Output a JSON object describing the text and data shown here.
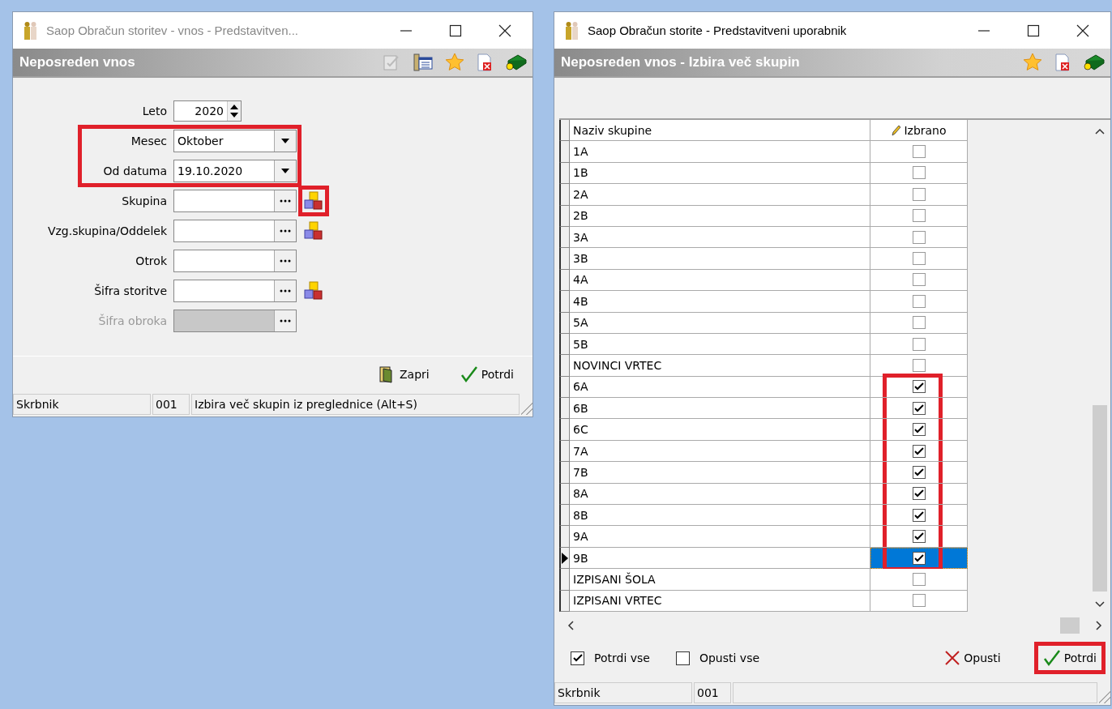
{
  "left_window": {
    "title": "Saop Obračun storitev - vnos - Predstavitven...",
    "active": false,
    "header": "Neposreden vnos",
    "toolbar": [
      {
        "kind": "edit"
      },
      {
        "kind": "list"
      },
      {
        "kind": "star"
      },
      {
        "kind": "close"
      },
      {
        "kind": "help"
      }
    ],
    "fields": [
      {
        "label": "Leto",
        "kind": "spinner",
        "value": "2020",
        "disabled": false,
        "highlighted": false
      },
      {
        "label": "Mesec",
        "kind": "dropdown",
        "value": "Oktober",
        "disabled": false,
        "highlighted": true
      },
      {
        "label": "Od datuma",
        "kind": "dropdown",
        "value": "19.10.2020",
        "disabled": false,
        "highlighted": true
      },
      {
        "label": "Skupina",
        "kind": "ellipsis",
        "disabled": false,
        "highlighted": false,
        "lookup": {
          "highlighted": true
        }
      },
      {
        "label": "Vzg.skupina/Oddelek",
        "kind": "ellipsis",
        "disabled": false,
        "highlighted": false,
        "lookup": {
          "highlighted": false
        }
      },
      {
        "label": "Otrok",
        "kind": "ellipsis",
        "disabled": false,
        "highlighted": false
      },
      {
        "label": "Šifra storitve",
        "kind": "ellipsis",
        "disabled": false,
        "highlighted": false,
        "lookup": {
          "highlighted": false
        }
      },
      {
        "label": "Šifra obroka",
        "kind": "ellipsis",
        "disabled": true,
        "highlighted": false
      }
    ],
    "buttons": [
      {
        "label": "Zapri",
        "kind": "close",
        "highlighted": false
      },
      {
        "label": "Potrdi",
        "kind": "confirm",
        "highlighted": false
      }
    ],
    "status_bar": [
      "Skrbnik",
      "001",
      "Izbira več skupin iz preglednice (Alt+S)"
    ]
  },
  "right_window": {
    "title": "Saop Obračun storite - Predstavitveni uporabnik",
    "active": true,
    "header": "Neposreden vnos - Izbira več skupin",
    "toolbar": [
      {
        "kind": "star"
      },
      {
        "kind": "close"
      },
      {
        "kind": "help"
      }
    ],
    "table": {
      "columns": [
        "Naziv skupine",
        "Izbrano"
      ],
      "rows": [
        {
          "name": "1A",
          "checked": false,
          "selected": false,
          "highlighted": false
        },
        {
          "name": "1B",
          "checked": false,
          "selected": false,
          "highlighted": false
        },
        {
          "name": "2A",
          "checked": false,
          "selected": false,
          "highlighted": false
        },
        {
          "name": "2B",
          "checked": false,
          "selected": false,
          "highlighted": false
        },
        {
          "name": "3A",
          "checked": false,
          "selected": false,
          "highlighted": false
        },
        {
          "name": "3B",
          "checked": false,
          "selected": false,
          "highlighted": false
        },
        {
          "name": "4A",
          "checked": false,
          "selected": false,
          "highlighted": false
        },
        {
          "name": "4B",
          "checked": false,
          "selected": false,
          "highlighted": false
        },
        {
          "name": "5A",
          "checked": false,
          "selected": false,
          "highlighted": false
        },
        {
          "name": "5B",
          "checked": false,
          "selected": false,
          "highlighted": false
        },
        {
          "name": "NOVINCI VRTEC",
          "checked": false,
          "selected": false,
          "highlighted": false
        },
        {
          "name": "6A",
          "checked": true,
          "selected": false,
          "highlighted": true
        },
        {
          "name": "6B",
          "checked": true,
          "selected": false,
          "highlighted": true
        },
        {
          "name": "6C",
          "checked": true,
          "selected": false,
          "highlighted": true
        },
        {
          "name": "7A",
          "checked": true,
          "selected": false,
          "highlighted": true
        },
        {
          "name": "7B",
          "checked": true,
          "selected": false,
          "highlighted": true
        },
        {
          "name": "8A",
          "checked": true,
          "selected": false,
          "highlighted": true
        },
        {
          "name": "8B",
          "checked": true,
          "selected": false,
          "highlighted": true
        },
        {
          "name": "9A",
          "checked": true,
          "selected": false,
          "highlighted": true
        },
        {
          "name": "9B",
          "checked": true,
          "selected": true,
          "highlighted": true
        },
        {
          "name": "IZPISANI ŠOLA",
          "checked": false,
          "selected": false,
          "highlighted": false
        },
        {
          "name": "IZPISANI VRTEC",
          "checked": false,
          "selected": false,
          "highlighted": false
        }
      ]
    },
    "options": [
      {
        "label": "Potrdi vse",
        "checked": true
      },
      {
        "label": "Opusti vse",
        "checked": false
      }
    ],
    "buttons": [
      {
        "label": "Opusti",
        "kind": "cancel",
        "highlighted": false
      },
      {
        "label": "Potrdi",
        "kind": "confirm",
        "highlighted": true
      }
    ],
    "status_bar": [
      "Skrbnik",
      "001"
    ]
  }
}
